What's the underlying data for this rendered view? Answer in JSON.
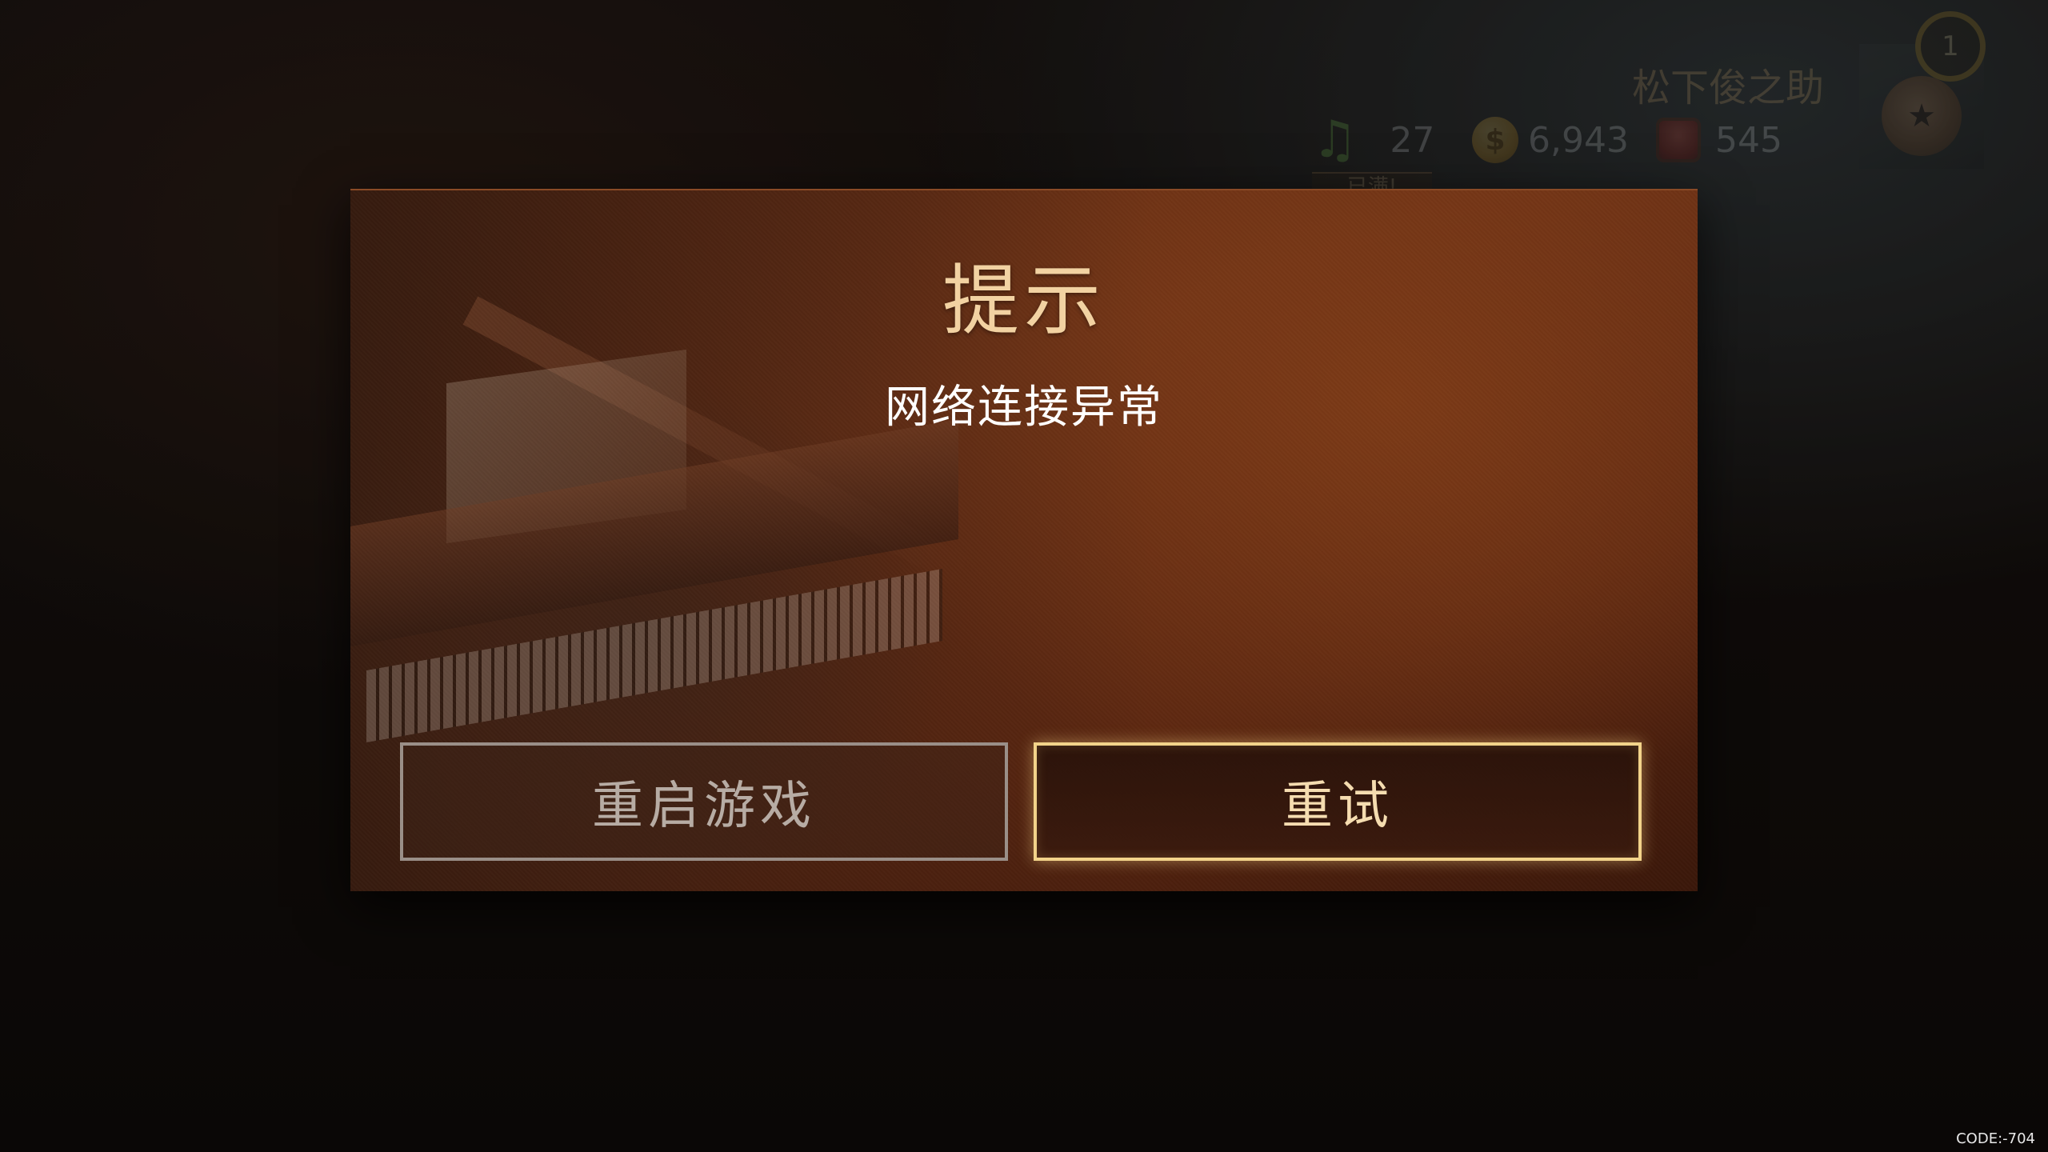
{
  "hud": {
    "player_name": "松下俊之助",
    "notes": "27",
    "coins": "6,943",
    "gems": "545",
    "badge_text": "已满!",
    "level": "1",
    "coin_symbol": "$",
    "note_icon": "music-note-icon",
    "coin_icon": "coin-icon",
    "gem_icon": "gem-icon"
  },
  "dialog": {
    "title": "提示",
    "message": "网络连接异常",
    "restart_label": "重启游戏",
    "retry_label": "重试"
  },
  "footer": {
    "code": "CODE:-704"
  },
  "colors": {
    "title": "#f2d2a2",
    "retry_border": "#f2d38a",
    "restart_border": "#9a8f88",
    "dialog_bg": "#6e3216"
  }
}
